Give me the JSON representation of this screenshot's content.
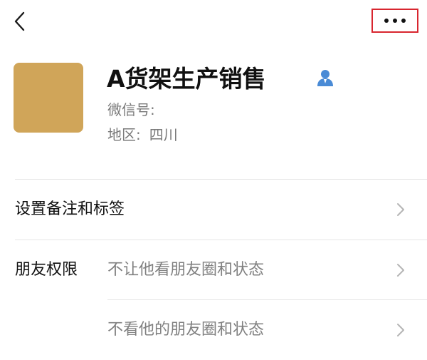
{
  "profile": {
    "name": "A货架生产销售",
    "wechat_id_label": "微信号:",
    "region_label": "地区:",
    "region_value": "四川",
    "avatar_color": "#d0a559"
  },
  "settings": {
    "remark_tags_label": "设置备注和标签",
    "friend_permissions_label": "朋友权限",
    "permissions": [
      {
        "label": "不让他看朋友圈和状态"
      },
      {
        "label": "不看他的朋友圈和状态"
      }
    ]
  },
  "colors": {
    "highlight_border": "#d8262f",
    "contact_icon": "#4a8bd6",
    "chevron": "#b5b5b5"
  },
  "icons": {
    "back": "chevron-left-icon",
    "more": "more-dots-icon",
    "contact": "contact-person-icon",
    "row_arrow": "chevron-right-icon"
  }
}
